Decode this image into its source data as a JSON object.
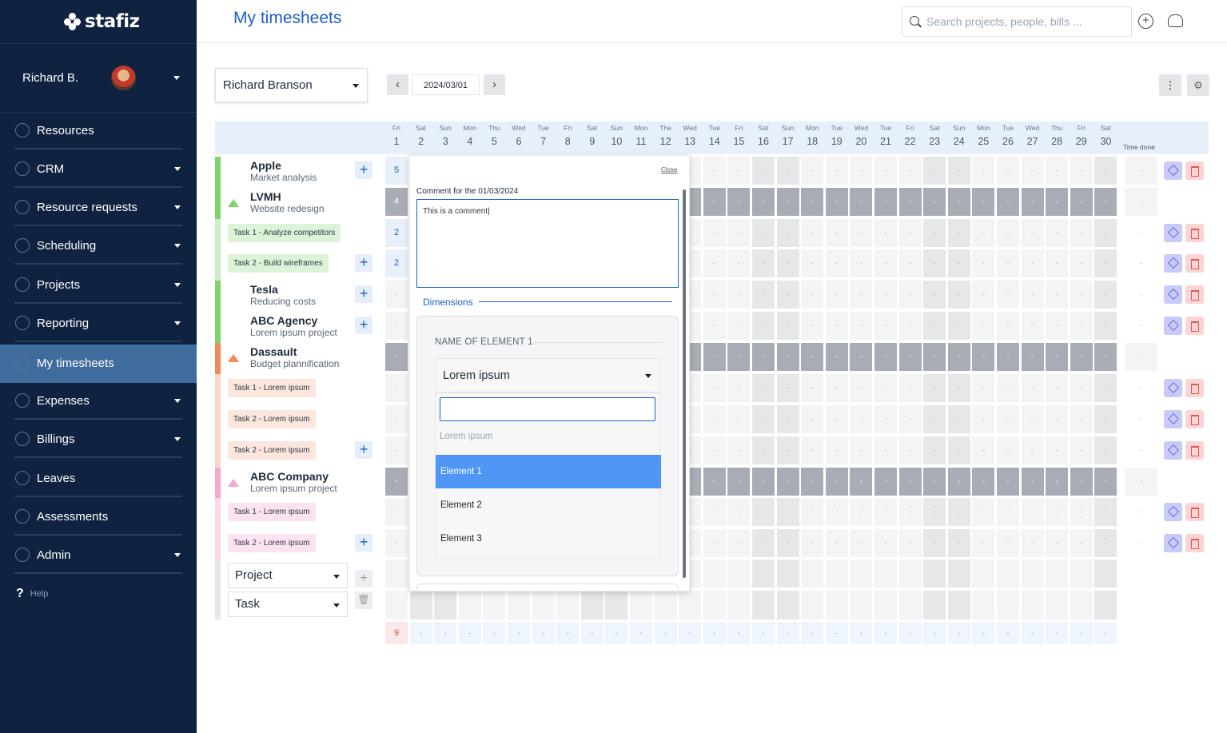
{
  "app": {
    "brand": "stafiz",
    "page_title": "My timesheets"
  },
  "topbar": {
    "search_placeholder": "Search projects, people, bills ..."
  },
  "user": {
    "name": "Richard B."
  },
  "nav": [
    {
      "label": "Resources"
    },
    {
      "label": "CRM"
    },
    {
      "label": "Resource requests"
    },
    {
      "label": "Scheduling"
    },
    {
      "label": "Projects"
    },
    {
      "label": "Reporting"
    },
    {
      "label": "My timesheets"
    },
    {
      "label": "Expenses"
    },
    {
      "label": "Billings"
    },
    {
      "label": "Leaves"
    },
    {
      "label": "Assessments"
    },
    {
      "label": "Admin"
    }
  ],
  "help": "Help",
  "toolbar": {
    "person": "Richard Branson",
    "date": "2024/03/01",
    "prev": "‹",
    "next": "›"
  },
  "days": [
    {
      "n": "Fri",
      "d": "1"
    },
    {
      "n": "Sat",
      "d": "2"
    },
    {
      "n": "Sun",
      "d": "3"
    },
    {
      "n": "Mon",
      "d": "4"
    },
    {
      "n": "Thu",
      "d": "5"
    },
    {
      "n": "Wed",
      "d": "6"
    },
    {
      "n": "Tue",
      "d": "7"
    },
    {
      "n": "Fri",
      "d": "8"
    },
    {
      "n": "Sat",
      "d": "9"
    },
    {
      "n": "Sun",
      "d": "10"
    },
    {
      "n": "Mon",
      "d": "11"
    },
    {
      "n": "The",
      "d": "12"
    },
    {
      "n": "Wed",
      "d": "13"
    },
    {
      "n": "Tue",
      "d": "14"
    },
    {
      "n": "Fri",
      "d": "15"
    },
    {
      "n": "Sat",
      "d": "16"
    },
    {
      "n": "Sun",
      "d": "17"
    },
    {
      "n": "Mon",
      "d": "18"
    },
    {
      "n": "Tue",
      "d": "19"
    },
    {
      "n": "Wed",
      "d": "20"
    },
    {
      "n": "Tue",
      "d": "21"
    },
    {
      "n": "Fri",
      "d": "22"
    },
    {
      "n": "Sat",
      "d": "23"
    },
    {
      "n": "Sun",
      "d": "24"
    },
    {
      "n": "Mon",
      "d": "25"
    },
    {
      "n": "Tue",
      "d": "26"
    },
    {
      "n": "Wed",
      "d": "27"
    },
    {
      "n": "Thu",
      "d": "28"
    },
    {
      "n": "Fri",
      "d": "29"
    },
    {
      "n": "Sat",
      "d": "30"
    }
  ],
  "time_done_label": "Time done",
  "rows": [
    {
      "project": "Apple",
      "sub": "Market analysis",
      "first": "5"
    },
    {
      "project": "LVMH",
      "sub": "Website redesign",
      "first": "4"
    },
    {
      "task": "Task 1 - Analyze competitors",
      "first": "2"
    },
    {
      "task": "Task 2 - Build wireframes",
      "first": "2"
    },
    {
      "project": "Tesla",
      "sub": "Reducing costs"
    },
    {
      "project": "ABC Agency",
      "sub": "Lorem ipsum project"
    },
    {
      "project": "Dassault",
      "sub": "Budget plannification"
    },
    {
      "task": "Task 1 - Lorem ipsum"
    },
    {
      "task": "Task 2 - Lorem ipsum"
    },
    {
      "task": "Task 2 - Lorem ipsum"
    },
    {
      "project": "ABC Company",
      "sub": "Lorem ipsum project"
    },
    {
      "task": "Task 1 - Lorem ipsum"
    },
    {
      "task": "Task 2 - Lorem ipsum"
    }
  ],
  "cell_text": "-",
  "total_first": "9",
  "adders": {
    "project": "Project",
    "task": "Task"
  },
  "popup": {
    "close": "Close",
    "label": "Comment for the 01/03/2024",
    "comment": "This is a comment|",
    "dimensions": "Dimensions",
    "element_title": "NAME OF ELEMENT 1",
    "selected": "Lorem ipsum",
    "search_placeholder": "Lorem ipsum",
    "options": [
      "Element 1",
      "Element 2",
      "Element 3"
    ]
  },
  "colors": {
    "sidebar": "#0f2340",
    "accent": "#1a5fc7",
    "selected_option": "#5096f5"
  }
}
